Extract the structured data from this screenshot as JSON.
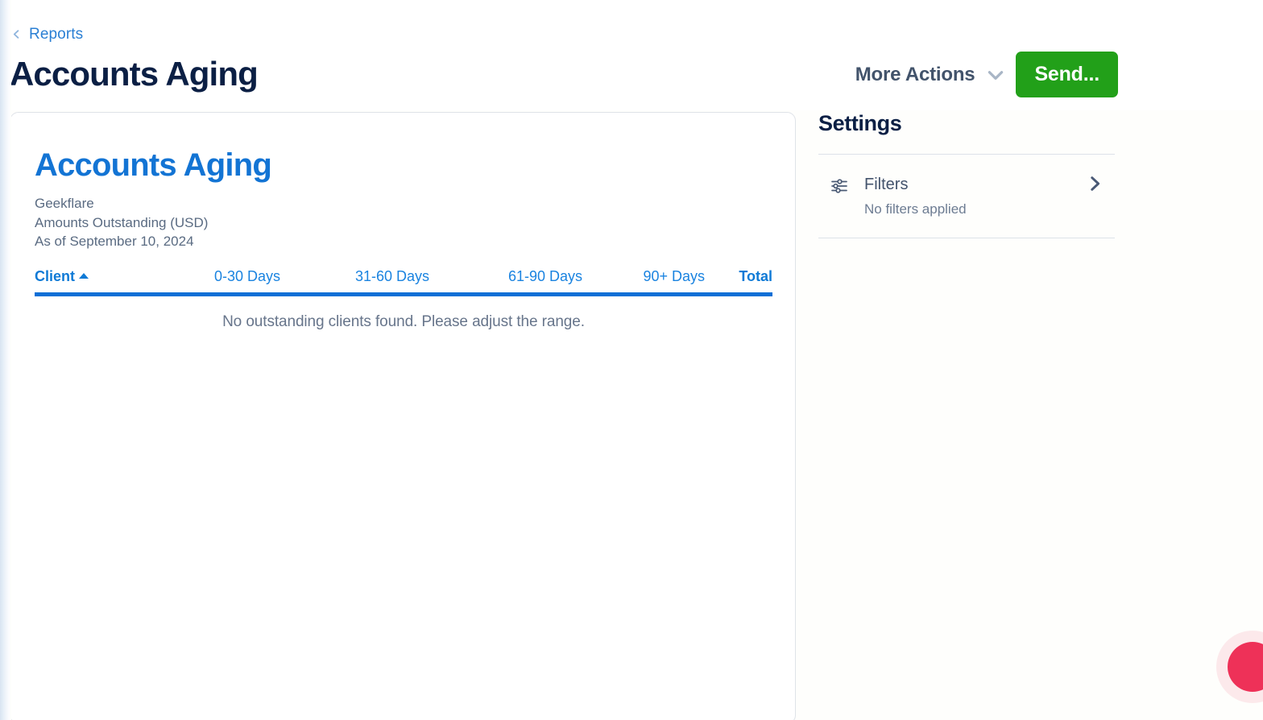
{
  "header": {
    "breadcrumb_label": "Reports",
    "back_icon": "chevron-left-icon",
    "page_title": "Accounts Aging",
    "more_actions_label": "More Actions",
    "more_actions_icon": "chevron-down-icon",
    "send_label": "Send..."
  },
  "report": {
    "title": "Accounts Aging",
    "company": "Geekflare",
    "subtitle": "Amounts Outstanding (USD)",
    "as_of": "As of September 10, 2024",
    "table": {
      "columns": [
        {
          "label": "Client",
          "sort": "asc",
          "sort_icon": "caret-up-icon"
        },
        {
          "label": "0-30 Days"
        },
        {
          "label": "31-60 Days"
        },
        {
          "label": "61-90 Days"
        },
        {
          "label": "90+ Days"
        },
        {
          "label": "Total"
        }
      ],
      "rows": [],
      "empty_message": "No outstanding clients found. Please adjust the range."
    }
  },
  "settings": {
    "title": "Settings",
    "filters": {
      "icon": "sliders-icon",
      "label": "Filters",
      "status": "No filters applied",
      "chevron_icon": "chevron-right-icon"
    }
  },
  "widgets": {
    "support_bubble": "support-chat-bubble"
  },
  "colors": {
    "accent_blue": "#0c6fd6",
    "link_blue": "#1a83e0",
    "send_green": "#22a019",
    "title_navy": "#0b1f44",
    "bubble_red": "#ee3158"
  }
}
